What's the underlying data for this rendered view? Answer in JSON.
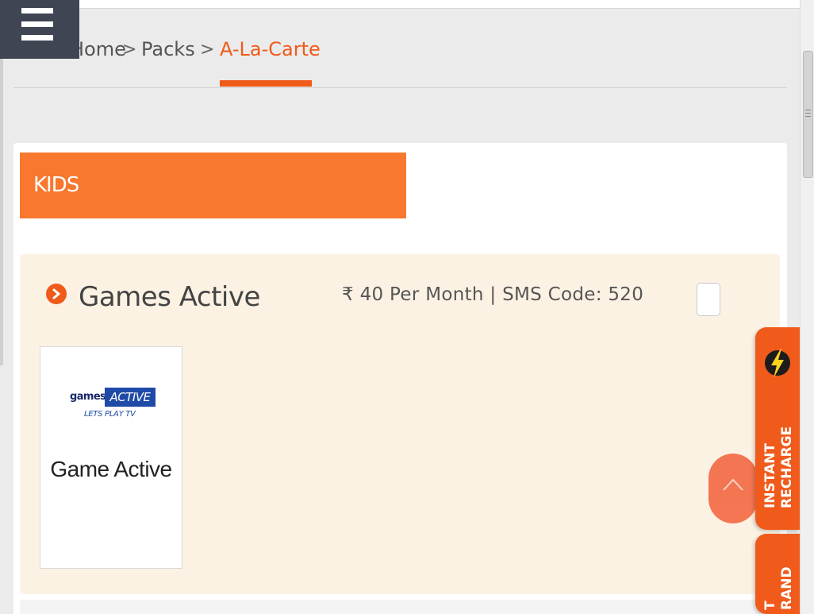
{
  "breadcrumb": {
    "home": "Home",
    "separator": ">",
    "packs": "Packs",
    "current": "A-La-Carte"
  },
  "category": {
    "title": "KIDS"
  },
  "pack": {
    "name": "Games Active",
    "currency_symbol": "₹",
    "price_text": "40 Per Month | SMS Code: 520",
    "selected": false
  },
  "channels": [
    {
      "name": "Game Active",
      "logo": {
        "word1": "games",
        "word2": "ACTIVE",
        "tagline": "LETS PLAY TV"
      }
    }
  ],
  "side_tabs": {
    "recharge": "INSTANT\nRECHARGE",
    "second": "T\nRAND"
  },
  "icons": {
    "menu": "hamburger-icon",
    "bullet": "chevron-right-circle-icon",
    "scroll_top": "chevron-up-icon",
    "recharge": "lightning-bolt-icon"
  },
  "colors": {
    "accent": "#f05a1a",
    "category_bar": "#f7782e",
    "pack_background": "#fcf2e4",
    "menu_background": "#3f4552"
  }
}
